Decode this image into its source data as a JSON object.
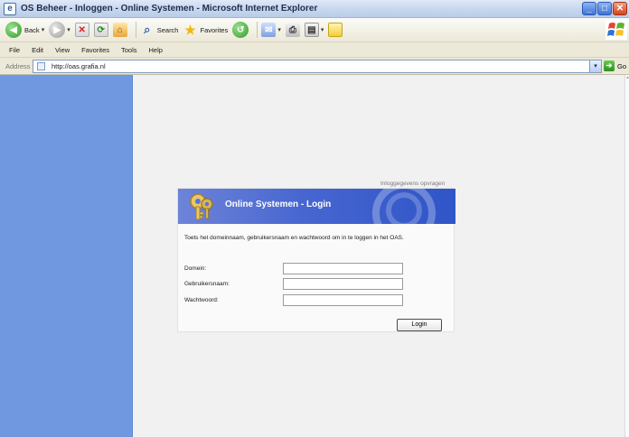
{
  "window": {
    "title": "OS Beheer - Inloggen - Online Systemen - Microsoft Internet Explorer",
    "buttons": [
      "_",
      "□",
      "✕"
    ]
  },
  "toolbar": {
    "back_label": "Back",
    "search_label": "Search",
    "favorites_label": "Favorites"
  },
  "menu": {
    "items": [
      "File",
      "Edit",
      "View",
      "Favorites",
      "Tools",
      "Help"
    ]
  },
  "address": {
    "label": "Address",
    "url": "http://oas.grafia.nl",
    "go_label": "Go"
  },
  "page": {
    "info_link": "Inloggegevens opvragen",
    "login": {
      "title": "Online Systemen - Login",
      "intro": "Toets het domeinnaam, gebruikersnaam en wachtwoord om in te loggen in het OAS.",
      "fields": [
        {
          "label": "Domein:",
          "value": ""
        },
        {
          "label": "Gebruikersnaam:",
          "value": ""
        },
        {
          "label": "Wachtwoord:",
          "value": ""
        }
      ],
      "button_label": "Login"
    }
  },
  "colors": {
    "sidebar": "#6f98e0",
    "header_blue": "#3a5ecc",
    "page_bg": "#f1f1f1"
  },
  "icons": [
    "ie-page-icon",
    "back-arrow-icon",
    "forward-arrow-icon",
    "stop-icon",
    "refresh-icon",
    "home-icon",
    "search-icon",
    "favorites-star-icon",
    "history-icon",
    "mail-icon",
    "print-icon",
    "edit-icon",
    "messenger-icon",
    "windows-logo-icon",
    "go-arrow-icon",
    "keys-icon"
  ]
}
